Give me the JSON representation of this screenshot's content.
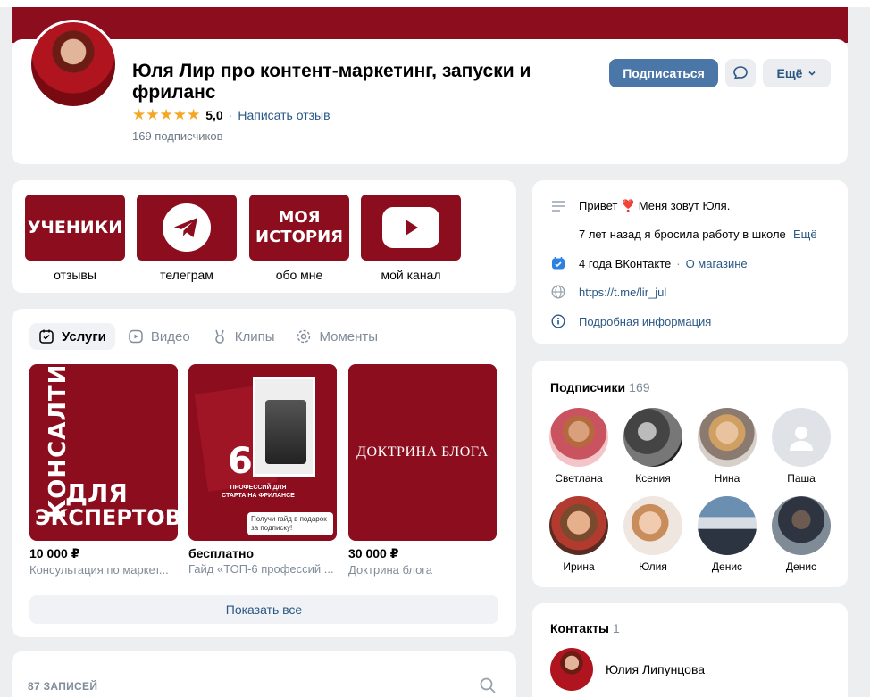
{
  "header": {
    "title": "Юля Лир про контент-маркетинг, запуски и фриланс",
    "stars": "★★★★★",
    "rating": "5,0",
    "dot": "·",
    "review_link": "Написать отзыв",
    "subscribers": "169 подписчиков",
    "subscribe_button": "Подписаться",
    "more_button": "Ещё"
  },
  "links": [
    {
      "image_text": "УЧЕНИКИ",
      "caption": "отзывы"
    },
    {
      "image_text": "",
      "caption": "телеграм",
      "icon": "telegram-icon"
    },
    {
      "image_text": "МОЯ ИСТОРИЯ",
      "caption": "обо мне"
    },
    {
      "image_text": "",
      "caption": "мой канал",
      "icon": "youtube-icon"
    }
  ],
  "services": {
    "tabs": [
      "Услуги",
      "Видео",
      "Клипы",
      "Моменты"
    ],
    "products": [
      {
        "image_text_1": "КОНСАЛТИНГ",
        "image_text_2": "ДЛЯ",
        "image_text_3": "ЭКСПЕРТОВ",
        "price": "10 000 ₽",
        "description": "Консультация по маркет..."
      },
      {
        "image_text_1": "6",
        "image_text_2": "ПРОФЕССИЙ ДЛЯ СТАРТА НА ФРИЛАНСЕ",
        "image_text_3": "Получи гайд в подарок за подписку!",
        "price": "бесплатно",
        "description": "Гайд «ТОП-6 профессий ..."
      },
      {
        "image_text_1": "ДОКТРИНА БЛОГА",
        "price": "30 000 ₽",
        "description": "Доктрина блога"
      }
    ],
    "show_all": "Показать все"
  },
  "posts": {
    "label": "87 ЗАПИСЕЙ"
  },
  "info": {
    "greeting": "Привет ❣️ Меня зовут Юля.",
    "line2": "7 лет назад я бросила работу в школе",
    "more": "Ещё",
    "years": "4 года ВКонтакте",
    "dot": "·",
    "about_link": "О магазине",
    "website": "https://t.me/lir_jul",
    "details": "Подробная информация"
  },
  "followers": {
    "title": "Подписчики",
    "count": "169",
    "people": [
      "Светлана",
      "Ксения",
      "Нина",
      "Паша",
      "Ирина",
      "Юлия",
      "Денис",
      "Денис"
    ]
  },
  "contacts": {
    "title": "Контакты",
    "count": "1",
    "name": "Юлия Липунцова"
  },
  "colors": {
    "brand": "#8c0d1e",
    "accent": "#4a76a8",
    "link": "#2a5885",
    "star": "#f5a623"
  }
}
